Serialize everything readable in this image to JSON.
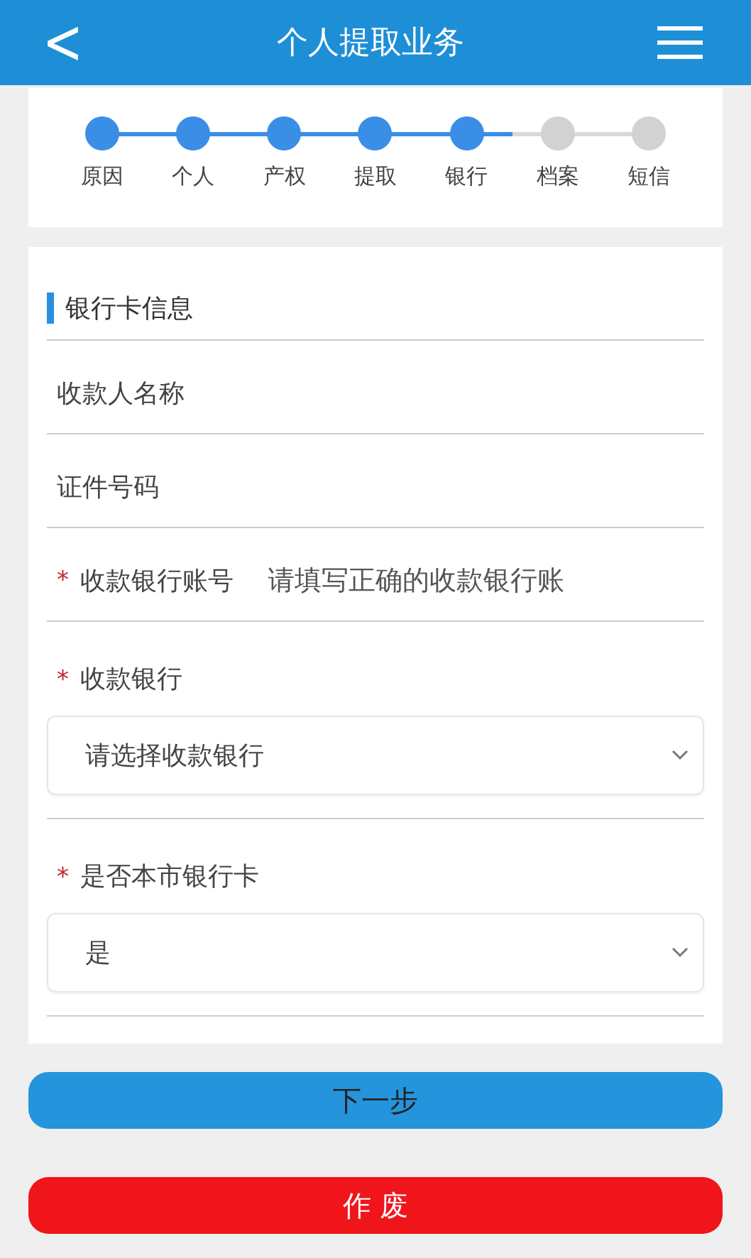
{
  "header": {
    "back": "<",
    "title": "个人提取业务"
  },
  "steps": [
    {
      "label": "原因",
      "done": true
    },
    {
      "label": "个人",
      "done": true
    },
    {
      "label": "产权",
      "done": true
    },
    {
      "label": "提取",
      "done": true
    },
    {
      "label": "银行",
      "done": true
    },
    {
      "label": "档案",
      "done": false
    },
    {
      "label": "短信",
      "done": false
    }
  ],
  "section": {
    "title": "银行卡信息"
  },
  "fields": [
    {
      "kind": "text",
      "label": "收款人名称"
    },
    {
      "kind": "text",
      "label": "证件号码"
    },
    {
      "kind": "text",
      "label": "收款银行账号",
      "required_mark": "*",
      "placeholder": "请填写正确的收款银行账"
    },
    {
      "kind": "select",
      "label": "收款银行",
      "required_mark": "*",
      "value": "请选择收款银行"
    },
    {
      "kind": "select",
      "label": "是否本市银行卡",
      "required_mark": "*",
      "value": "是"
    }
  ],
  "buttons": [
    {
      "kind": "primary",
      "label": "下一步"
    },
    {
      "kind": "danger",
      "label": "作 废"
    }
  ]
}
